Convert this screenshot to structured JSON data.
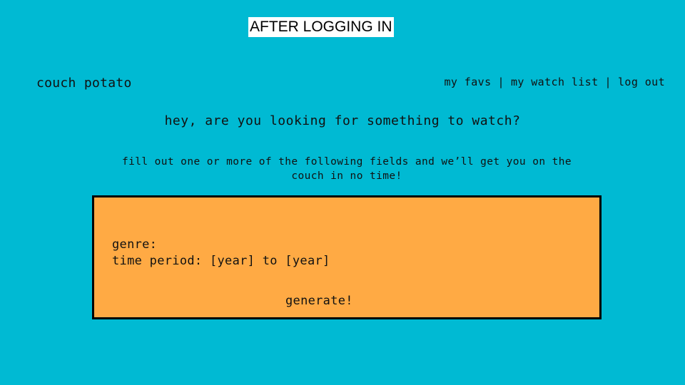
{
  "slide_title": "AFTER LOGGING IN",
  "brand": "couch potato",
  "nav": {
    "items": [
      "my favs",
      "my watch list",
      "log out"
    ],
    "separator": "|"
  },
  "headline": "hey, are you looking for something to watch?",
  "subline": "fill out one or more of the following fields and we’ll get you on the couch in no time!",
  "form": {
    "genre_label": "genre:",
    "time_period_label": "time period:",
    "year_start_placeholder": "[year]",
    "to_label": "to",
    "year_end_placeholder": "[year]",
    "generate_label": "generate!"
  },
  "colors": {
    "background": "#00bad3",
    "panel": "#ffaa44",
    "panel_border": "#000000"
  }
}
